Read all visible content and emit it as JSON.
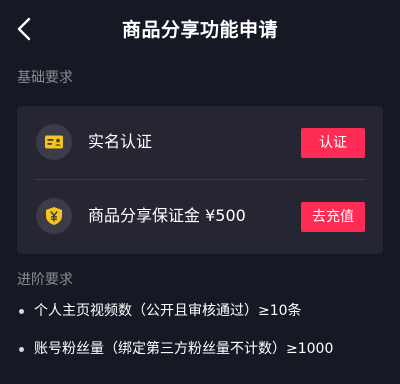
{
  "header": {
    "title": "商品分享功能申请",
    "back_icon": "chevron-left-icon"
  },
  "basic": {
    "title": "基础要求",
    "items": [
      {
        "label": "实名认证",
        "action": "认证",
        "icon": "id-card-icon"
      },
      {
        "label": "商品分享保证金 ¥500",
        "action": "去充值",
        "icon": "yen-shield-icon"
      }
    ]
  },
  "advanced": {
    "title": "进阶要求",
    "items": [
      {
        "text": "个人主页视频数（公开且审核通过）≥10条"
      },
      {
        "text": "账号粉丝量（绑定第三方粉丝量不计数）≥1000"
      }
    ]
  },
  "colors": {
    "background": "#161823",
    "card": "#252632",
    "accent": "#fe2c55",
    "icon_yellow": "#f5c518",
    "muted_text": "#8a8b93"
  }
}
